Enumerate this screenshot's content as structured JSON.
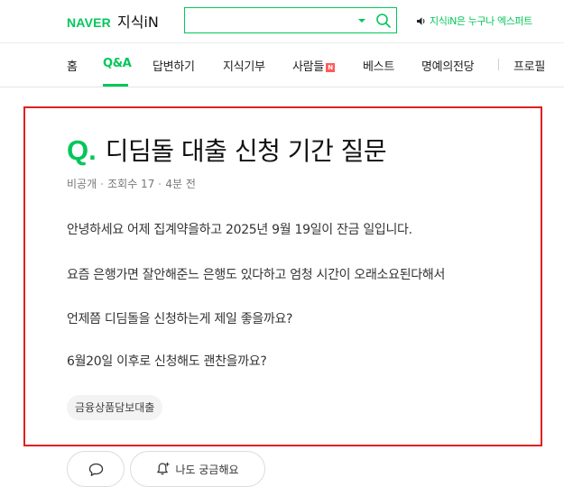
{
  "header": {
    "brand": "NAVER",
    "service": "지식iN",
    "search": {
      "value": "",
      "placeholder": ""
    },
    "promo_text": "지식iN은 누구나 엑스퍼트"
  },
  "nav": {
    "items": [
      {
        "label": "홈"
      },
      {
        "label": "Q&A",
        "active": true
      },
      {
        "label": "답변하기"
      },
      {
        "label": "지식기부"
      },
      {
        "label": "사람들",
        "badge": "N"
      },
      {
        "label": "베스트"
      },
      {
        "label": "명예의전당"
      },
      {
        "label": "프로필"
      }
    ]
  },
  "question": {
    "mark": "Q.",
    "title": "디딤돌 대출 신청 기간 질문",
    "meta": {
      "author": "비공개",
      "views": "조회수 17",
      "time": "4분 전"
    },
    "body": [
      "안녕하세요  어제 집계약을하고 2025년 9월 19일이 잔금 일입니다.",
      "요즘 은행가면 잘안해준느 은행도 있다하고 엄청 시간이 오래소요된다해서",
      "언제쯤 디딤돌을 신청하는게 제일 좋을까요?",
      "6월20일 이후로 신청해도 괜찬을까요?"
    ],
    "tag": "금융상품담보대출"
  },
  "actions": {
    "curious_label": "나도 궁금해요"
  },
  "colors": {
    "brand_green": "#03c75a",
    "highlight_red": "#e02020",
    "badge_red": "#ff5a5a"
  }
}
